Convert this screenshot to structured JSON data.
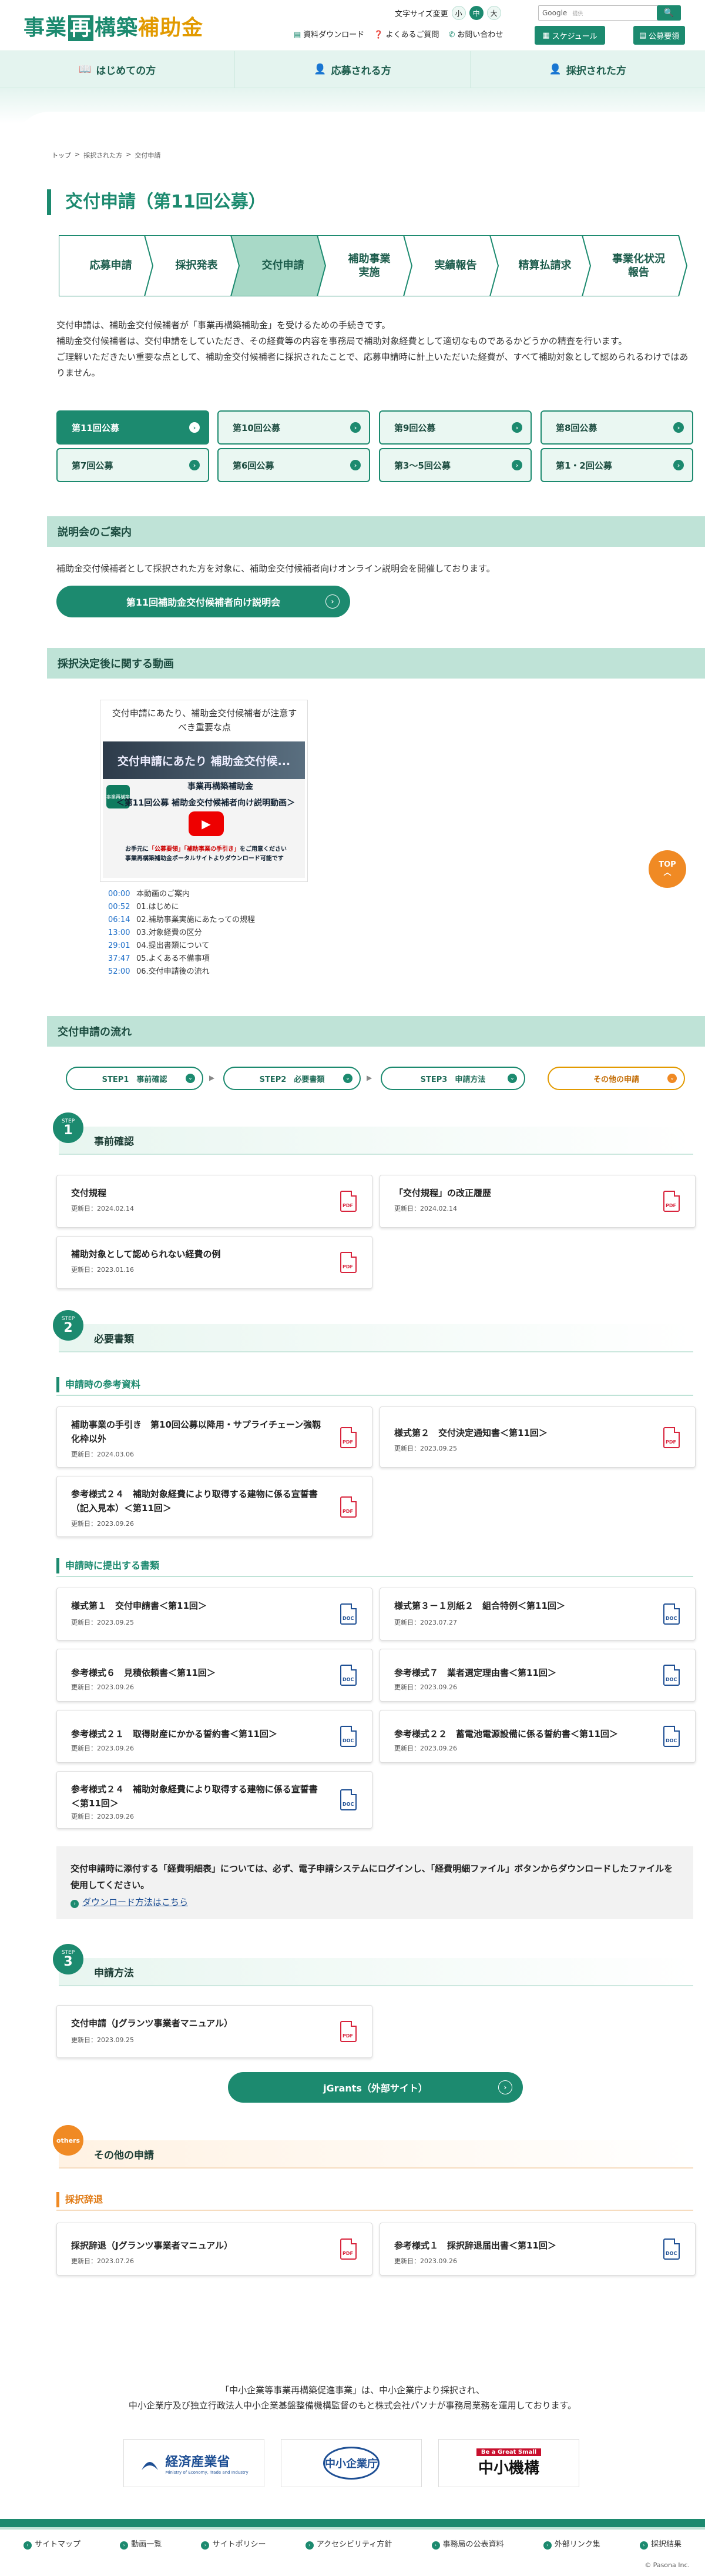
{
  "header": {
    "logo": {
      "part1": "事業",
      "boxed": "再",
      "part2": "構築",
      "part3": "補助金"
    },
    "font_size_label": "文字サイズ変更",
    "font_sizes": [
      "小",
      "中",
      "大"
    ],
    "search_label": "Google",
    "search_sub": "提供",
    "search_button": "🔍",
    "links": [
      "資料ダウンロード",
      "よくあるご質問",
      "お問い合わせ"
    ],
    "schedule_button": "スケジュール",
    "announce_button": "公募要領"
  },
  "gnav": [
    "はじめての方",
    "応募される方",
    "採択された方"
  ],
  "breadcrumb": [
    "トップ",
    "採択された方",
    "交付申請"
  ],
  "page_title": "交付申請（第11回公募）",
  "steps": [
    "応募申請",
    "採択発表",
    "交付申請",
    "補助事業\n実施",
    "実績報告",
    "精算払請求",
    "事業化状況\n報告"
  ],
  "intro": [
    "交付申請は、補助金交付候補者が「事業再構築補助金」を受けるための手続きです。",
    "補助金交付候補者は、交付申請をしていただき、その経費等の内容を事務局で補助対象経費として適切なものであるかどうかの精査を行います。",
    "ご理解いただきたい重要な点として、補助金交付候補者に採択されたことで、応募申請時に計上いただいた経費が、すべて補助対象として認められるわけではありません。"
  ],
  "tabs": [
    "第11回公募",
    "第10回公募",
    "第9回公募",
    "第8回公募",
    "第7回公募",
    "第6回公募",
    "第3〜5回公募",
    "第1・2回公募"
  ],
  "briefing": {
    "heading": "説明会のご案内",
    "text": "補助金交付候補者として採択された方を対象に、補助金交付候補者向けオンライン説明会を開催しております。",
    "button": "第11回補助金交付候補者向け説明会"
  },
  "video": {
    "heading": "採択決定後に関する動画",
    "title": "交付申請にあたり、補助金交付候補者が注意すべき重要な点",
    "thumb_top": "交付申請にあたり 補助金交付候...",
    "thumb_logo": "事業再構築",
    "thumb_line1": "事業再構築補助金",
    "thumb_line2": "＜第11回公募 補助金交付候補者向け説明動画＞",
    "thumb_note1_a": "お手元に",
    "thumb_note1_b": "「公募要領」「補助事業の手引き」",
    "thumb_note1_c": "をご用意ください",
    "thumb_note2": "事業再構築補助金ポータルサイトよりダウンロード可能です",
    "chapters": [
      {
        "t": "00:00",
        "label": "本動画のご案内"
      },
      {
        "t": "00:52",
        "label": "01.はじめに"
      },
      {
        "t": "06:14",
        "label": "02.補助事業実施にあたっての規程"
      },
      {
        "t": "13:00",
        "label": "03.対象経費の区分"
      },
      {
        "t": "29:01",
        "label": "04.提出書類について"
      },
      {
        "t": "37:47",
        "label": "05.よくある不備事項"
      },
      {
        "t": "52:00",
        "label": "06.交付申請後の流れ"
      }
    ]
  },
  "topbutton": {
    "label": "TOP",
    "arrow": "︿"
  },
  "flow": {
    "heading": "交付申請の流れ",
    "steps": [
      "STEP1　事前確認",
      "STEP2　必要書類",
      "STEP3　申請方法",
      "その他の申請"
    ]
  },
  "step1": {
    "badge_s": "STEP",
    "badge_n": "1",
    "title": "事前確認",
    "cards": [
      {
        "title": "交付規程",
        "date": "更新日：2024.02.14",
        "icon": "PDF"
      },
      {
        "title": "「交付規程」の改正履歴",
        "date": "更新日：2024.02.14",
        "icon": "PDF"
      },
      {
        "title": "補助対象として認められない経費の例",
        "date": "更新日：2023.01.16",
        "icon": "PDF"
      }
    ]
  },
  "step2": {
    "badge_s": "STEP",
    "badge_n": "2",
    "title": "必要書類",
    "sub1": "申請時の参考資料",
    "ref_cards": [
      {
        "title": "補助事業の手引き　第10回公募以降用・サプライチェーン強靱化枠以外",
        "date": "更新日：2024.03.06",
        "icon": "PDF"
      },
      {
        "title": "様式第２　交付決定通知書＜第11回＞",
        "date": "更新日：2023.09.25",
        "icon": "PDF"
      },
      {
        "title": "参考様式２４　補助対象経費により取得する建物に係る宣誓書（記入見本）＜第11回＞",
        "date": "更新日：2023.09.26",
        "icon": "PDF"
      }
    ],
    "sub2": "申請時に提出する書類",
    "sub_cards": [
      {
        "title": "様式第１　交付申請書＜第11回＞",
        "date": "更新日：2023.09.25",
        "icon": "DOC"
      },
      {
        "title": "様式第３－１別紙２　組合特例＜第11回＞",
        "date": "更新日：2023.07.27",
        "icon": "DOC"
      },
      {
        "title": "参考様式６　見積依頼書＜第11回＞",
        "date": "更新日：2023.09.26",
        "icon": "DOC"
      },
      {
        "title": "参考様式７　業者選定理由書＜第11回＞",
        "date": "更新日：2023.09.26",
        "icon": "DOC"
      },
      {
        "title": "参考様式２１　取得財産にかかる誓約書＜第11回＞",
        "date": "更新日：2023.09.26",
        "icon": "DOC"
      },
      {
        "title": "参考様式２２　蓄電池電源設備に係る誓約書＜第11回＞",
        "date": "更新日：2023.09.26",
        "icon": "DOC"
      },
      {
        "title": "参考様式２４　補助対象経費により取得する建物に係る宣誓書＜第11回＞",
        "date": "更新日：2023.09.26",
        "icon": "DOC"
      }
    ],
    "notice": "交付申請時に添付する「経費明細表」については、必ず、電子申請システムにログインし、「経費明細ファイル」ボタンからダウンロードしたファイルを使用してください。",
    "notice_link": "ダウンロード方法はこちら"
  },
  "step3": {
    "badge_s": "STEP",
    "badge_n": "3",
    "title": "申請方法",
    "cards": [
      {
        "title": "交付申請（Jグランツ事業者マニュアル）",
        "date": "更新日：2023.09.25",
        "icon": "PDF"
      }
    ],
    "button": "jGrants（外部サイト）"
  },
  "others": {
    "badge": "others",
    "title": "その他の申請",
    "sub": "採択辞退",
    "cards": [
      {
        "title": "採択辞退（Jグランツ事業者マニュアル）",
        "date": "更新日：2023.07.26",
        "icon": "PDF"
      },
      {
        "title": "参考様式１　採択辞退届出書＜第11回＞",
        "date": "更新日：2023.09.26",
        "icon": "DOC"
      }
    ]
  },
  "footer": {
    "text1": "「中小企業等事業再構築促進事業」は、中小企業庁より採択され、",
    "text2": "中小企業庁及び独立行政法人中小企業基盤整備機構監督のもと株式会社パソナが事務局業務を運用しております。",
    "logo1": "経済産業省",
    "logo1_sub": "Ministry of Economy, Trade and Industry",
    "logo2": "中小企業庁",
    "logo3_sub": "Be a Great Small",
    "logo3": "中小機構",
    "links": [
      "サイトマップ",
      "動画一覧",
      "サイトポリシー",
      "アクセシビリティ方針",
      "事務局の公表資料",
      "外部リンク集",
      "採択結果"
    ],
    "copyright": "© Pasona Inc."
  },
  "colors": {
    "primary": "#1c8a6f",
    "accent": "#e29a00",
    "pdf": "#d8243c",
    "doc": "#1e4f94"
  }
}
